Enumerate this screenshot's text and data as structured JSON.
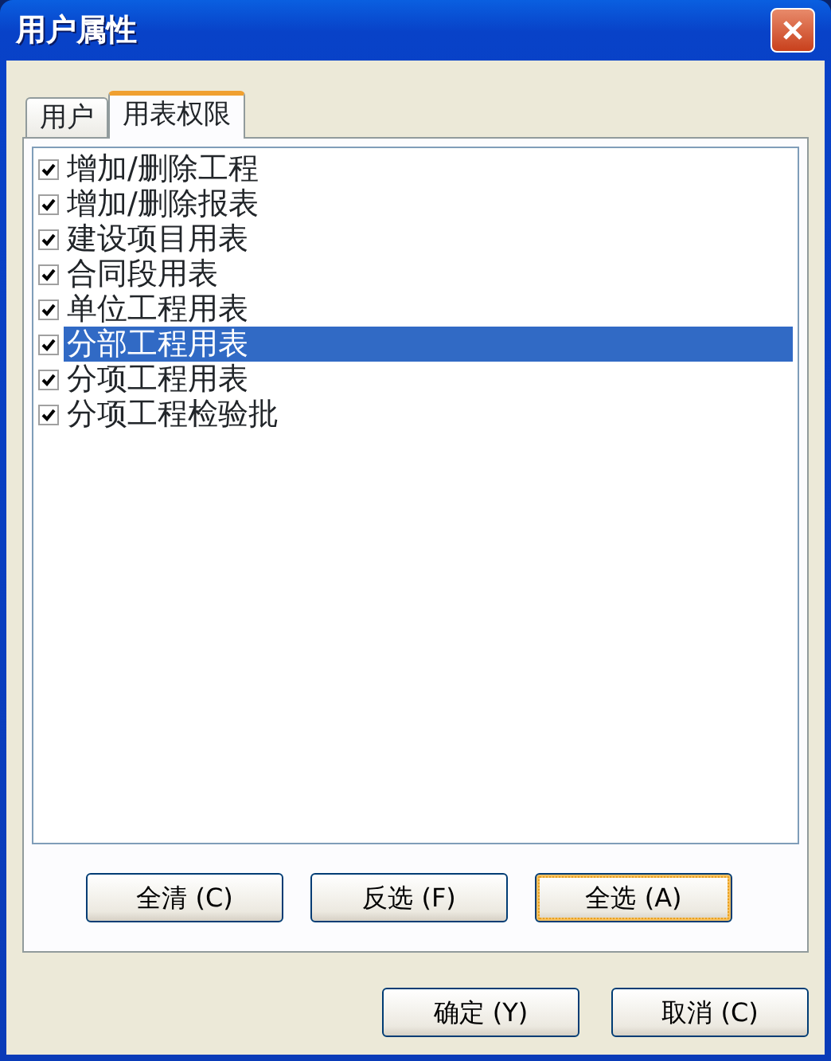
{
  "window": {
    "title": "用户属性"
  },
  "tabs": [
    {
      "label": "用户",
      "selected": false
    },
    {
      "label": "用表权限",
      "selected": true
    }
  ],
  "items": [
    {
      "label": "增加/删除工程",
      "checked": true,
      "selected": false
    },
    {
      "label": "增加/删除报表",
      "checked": true,
      "selected": false
    },
    {
      "label": "建设项目用表",
      "checked": true,
      "selected": false
    },
    {
      "label": "合同段用表",
      "checked": true,
      "selected": false
    },
    {
      "label": "单位工程用表",
      "checked": true,
      "selected": false
    },
    {
      "label": "分部工程用表",
      "checked": true,
      "selected": true
    },
    {
      "label": "分项工程用表",
      "checked": true,
      "selected": false
    },
    {
      "label": "分项工程检验批",
      "checked": true,
      "selected": false
    }
  ],
  "panel_buttons": [
    {
      "label": "全清 (C)",
      "focused": false
    },
    {
      "label": "反选 (F)",
      "focused": false
    },
    {
      "label": "全选 (A)",
      "focused": true
    }
  ],
  "dialog_buttons": [
    "确定 (Y)",
    "取消 (C)"
  ]
}
